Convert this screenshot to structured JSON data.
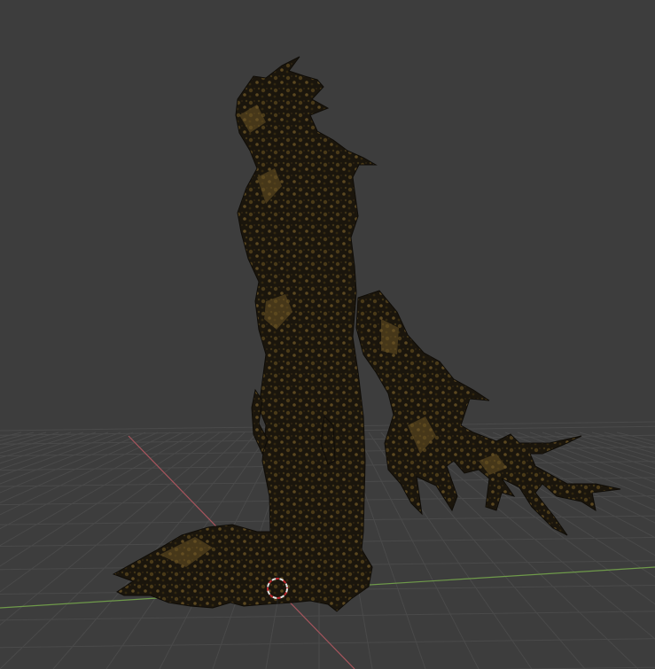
{
  "viewport": {
    "background": "#3d3d3d",
    "grid_color": "#4a4a4a",
    "x_axis_color": "#a8555d",
    "y_axis_color": "#6f9a4a",
    "model_dark": "#17130b",
    "model_mid": "#3a2f17",
    "model_highlight": "#6b5424"
  },
  "cursor": {
    "icon": "3d-cursor-icon",
    "ring_colors": [
      "#e4e4e4",
      "#c0272d"
    ]
  },
  "model": {
    "icon": "tree-creature-mesh"
  }
}
